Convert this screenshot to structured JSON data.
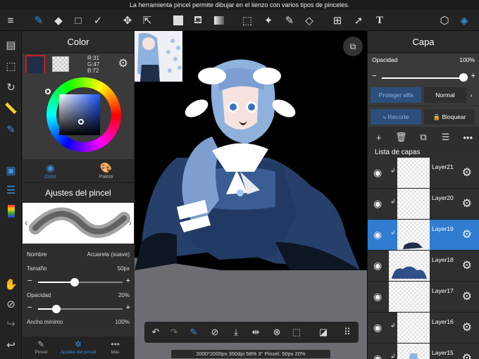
{
  "status_message": "La herramienta pincel permite dibujar en el lienzo con varios tipos de pinceles.",
  "color_panel": {
    "title": "Color",
    "rgb_r": "R:31",
    "rgb_g": "G:47",
    "rgb_b": "B:72",
    "main_color": "#1f2f48",
    "tab_color": "Color",
    "tab_palette": "Paleta"
  },
  "brush_panel": {
    "title": "Ajustes del pincel",
    "name_label": "Nombre",
    "name_value": "Acuarela (suave)",
    "size_label": "Tamaño",
    "size_value": "50px",
    "opacity_label": "Opacidad",
    "opacity_value": "20%",
    "min_width_label": "Ancho mínimo",
    "min_width_value": "100%"
  },
  "bottom_tabs": {
    "brush": "Pincel",
    "brush_settings": "Ajustes del pincel",
    "more": "Más"
  },
  "canvas_info": "2000*2000px 350dpi 58% 3° Pincel: 50px 20%",
  "layer_panel": {
    "title": "Capa",
    "opacity_label": "Opacidad",
    "opacity_value": "100%",
    "protect_alpha": "Proteger alfa",
    "blend_mode": "Normal",
    "clip": "Recorte",
    "lock": "Bloquear",
    "list_title": "Lista de capas",
    "layers": [
      {
        "name": "Layer21"
      },
      {
        "name": "Layer20"
      },
      {
        "name": "Layer19"
      },
      {
        "name": "Layer18"
      },
      {
        "name": "Layer17"
      },
      {
        "name": "Layer16"
      },
      {
        "name": "Layer15"
      }
    ]
  },
  "accent_color": "#2f7cd0"
}
